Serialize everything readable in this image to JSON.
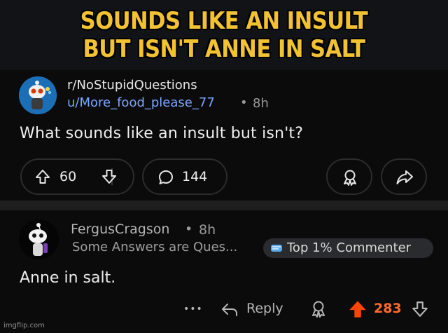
{
  "meme": {
    "line1": "SOUNDS LIKE AN INSULT",
    "line2": "BUT ISN'T ANNE IN SALT"
  },
  "post": {
    "subreddit": "r/NoStupidQuestions",
    "author": "u/More_food_please_77",
    "separator": "•",
    "age": "8h",
    "title": "What sounds like an insult but isn't?",
    "upvotes": "60",
    "comments": "144",
    "icons": [
      "upvote-icon",
      "downvote-icon",
      "comment-icon",
      "award-icon",
      "share-icon"
    ]
  },
  "comment": {
    "author": "FergusCragson",
    "separator": "•",
    "age": "8h",
    "flair": "Some Answers are Ques...",
    "badge": "Top 1% Commenter",
    "body": "Anne in salt.",
    "more": "•••",
    "reply_label": "Reply",
    "score": "283",
    "colors": {
      "score": "#ff6a2c",
      "upvote_active": "#ff4500"
    },
    "icons": [
      "more-icon",
      "reply-icon",
      "award-icon",
      "upvote-icon",
      "downvote-icon"
    ]
  },
  "watermark": "imgflip.com"
}
